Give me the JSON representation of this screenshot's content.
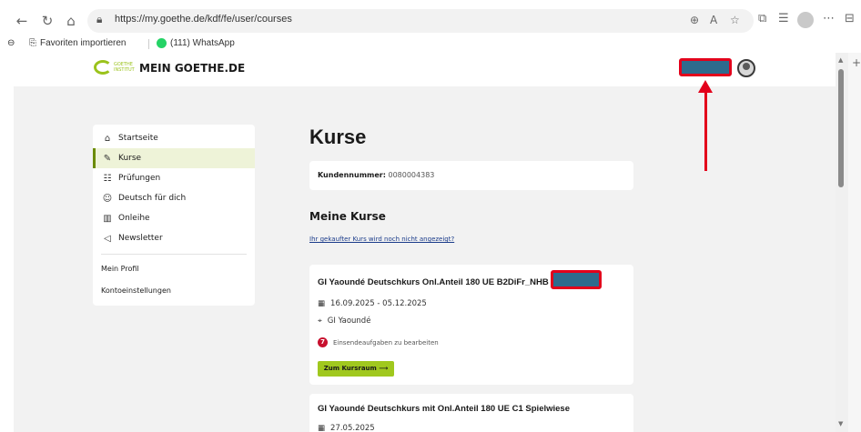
{
  "browser": {
    "url": "https://my.goethe.de/kdf/fe/user/courses",
    "icons": {
      "back": "back-arrow-icon",
      "refresh": "refresh-icon",
      "home": "home-icon",
      "lock": "lock-icon",
      "zoom": "zoom-icon",
      "read_aloud": "read-aloud-icon",
      "favorite": "star-icon",
      "split": "split-screen-icon",
      "collections": "collections-icon",
      "profile": "profile-icon",
      "more": "more-icon"
    },
    "favorites": [
      {
        "label": "Favoriten importieren"
      },
      {
        "label": "(111) WhatsApp"
      }
    ]
  },
  "header": {
    "logo_text": "GOETHE INSTITUT",
    "site_name": "MEIN GOETHE.DE"
  },
  "sidebar": {
    "items": [
      {
        "label": "Startseite",
        "icon": "home-icon",
        "glyph": "⌂"
      },
      {
        "label": "Kurse",
        "icon": "course-icon",
        "glyph": "✎"
      },
      {
        "label": "Prüfungen",
        "icon": "exam-icon",
        "glyph": "☷"
      },
      {
        "label": "Deutsch für dich",
        "icon": "community-icon",
        "glyph": "☺"
      },
      {
        "label": "Onleihe",
        "icon": "library-icon",
        "glyph": "▥"
      },
      {
        "label": "Newsletter",
        "icon": "megaphone-icon",
        "glyph": "◁"
      }
    ],
    "active_index": 1,
    "secondary": [
      {
        "label": "Mein Profil"
      },
      {
        "label": "Kontoeinstellungen"
      }
    ]
  },
  "main": {
    "title": "Kurse",
    "customer_label": "Kundennummer:",
    "customer_number": "0080004383",
    "section_title": "Meine Kurse",
    "missing_link": "Ihr gekaufter Kurs wird noch nicht angezeigt?",
    "courses": [
      {
        "title": "GI Yaoundé Deutschkurs Onl.Anteil 180 UE B2DiFr_NHB",
        "dates": "16.09.2025 - 05.12.2025",
        "location": "GI Yaoundé",
        "task_count": "7",
        "task_text": "Einsendeaufgaben zu bearbeiten",
        "cta": "Zum Kursraum ⟶"
      },
      {
        "title": "GI Yaoundé Deutschkurs mit Onl.Anteil 180 UE C1 Spielwiese",
        "dates": "27.05.2025"
      }
    ]
  },
  "colors": {
    "accent_green": "#a0c81e",
    "annotation_red": "#e3001b",
    "redaction_blue": "#2e6b8d",
    "badge_red": "#c8102e"
  }
}
